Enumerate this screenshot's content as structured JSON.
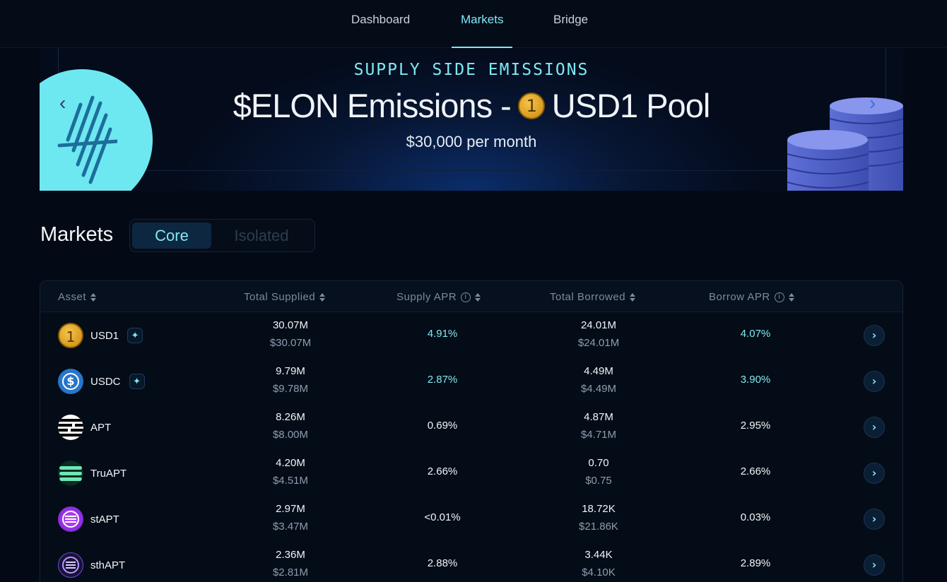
{
  "nav": {
    "items": [
      {
        "label": "Dashboard"
      },
      {
        "label": "Markets",
        "active": true
      },
      {
        "label": "Bridge"
      }
    ]
  },
  "banner": {
    "kicker": "SUPPLY SIDE EMISSIONS",
    "title_left": "$ELON Emissions -",
    "title_coin_glyph": "1",
    "title_right": "USD1 Pool",
    "subtitle": "$30,000 per month",
    "prev_arrow": "‹",
    "next_arrow": "›"
  },
  "markets": {
    "title": "Markets",
    "tabs": [
      {
        "label": "Core",
        "active": true
      },
      {
        "label": "Isolated",
        "active": false
      }
    ]
  },
  "table": {
    "headers": {
      "asset": "Asset",
      "total_supplied": "Total Supplied",
      "supply_apr": "Supply APR",
      "total_borrowed": "Total Borrowed",
      "borrow_apr": "Borrow APR",
      "info_glyph": "i"
    },
    "rows": [
      {
        "asset": "USD1",
        "icon": "usd1-coin-icon",
        "badge": "✦",
        "supplied": "30.07M",
        "supplied_usd": "$30.07M",
        "supply_apr": "4.91%",
        "borrowed": "24.01M",
        "borrowed_usd": "$24.01M",
        "borrow_apr": "4.07%",
        "highlight": true
      },
      {
        "asset": "USDC",
        "icon": "usdc-coin-icon",
        "badge": "✦",
        "supplied": "9.79M",
        "supplied_usd": "$9.78M",
        "supply_apr": "2.87%",
        "borrowed": "4.49M",
        "borrowed_usd": "$4.49M",
        "borrow_apr": "3.90%",
        "highlight": true
      },
      {
        "asset": "APT",
        "icon": "aptos-icon",
        "badge": "",
        "supplied": "8.26M",
        "supplied_usd": "$8.00M",
        "supply_apr": "0.69%",
        "borrowed": "4.87M",
        "borrowed_usd": "$4.71M",
        "borrow_apr": "2.95%",
        "highlight": false
      },
      {
        "asset": "TruAPT",
        "icon": "truapt-icon",
        "badge": "",
        "supplied": "4.20M",
        "supplied_usd": "$4.51M",
        "supply_apr": "2.66%",
        "borrowed": "0.70",
        "borrowed_usd": "$0.75",
        "borrow_apr": "2.66%",
        "highlight": false
      },
      {
        "asset": "stAPT",
        "icon": "stapt-icon",
        "badge": "",
        "supplied": "2.97M",
        "supplied_usd": "$3.47M",
        "supply_apr": "<0.01%",
        "borrowed": "18.72K",
        "borrowed_usd": "$21.86K",
        "borrow_apr": "0.03%",
        "highlight": false
      },
      {
        "asset": "sthAPT",
        "icon": "sthapt-icon",
        "badge": "",
        "supplied": "2.36M",
        "supplied_usd": "$2.81M",
        "supply_apr": "2.88%",
        "borrowed": "3.44K",
        "borrowed_usd": "$4.10K",
        "borrow_apr": "2.89%",
        "highlight": false
      }
    ],
    "row_action_glyph": "›"
  },
  "colors": {
    "accent": "#7fe9f2",
    "background": "#030a15",
    "muted": "#7c8ba0"
  }
}
